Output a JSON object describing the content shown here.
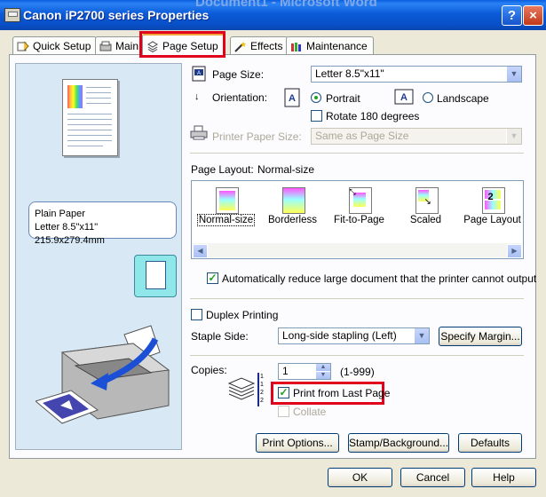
{
  "window": {
    "title": "Canon iP2700 series Properties",
    "background_title": "Document1 - Microsoft Word",
    "help_label": "?",
    "close_label": "×"
  },
  "tabs": [
    {
      "label": "Quick Setup",
      "icon": "quick-setup-icon"
    },
    {
      "label": "Main",
      "icon": "main-icon"
    },
    {
      "label": "Page Setup",
      "icon": "page-setup-icon",
      "active": true
    },
    {
      "label": "Effects",
      "icon": "effects-icon"
    },
    {
      "label": "Maintenance",
      "icon": "maintenance-icon"
    }
  ],
  "preview": {
    "media_line1": "Plain Paper",
    "media_line2": "Letter 8.5\"x11\" 215.9x279.4mm"
  },
  "form": {
    "page_size_label": "Page Size:",
    "page_size_value": "Letter 8.5\"x11\"",
    "orientation_label": "Orientation:",
    "portrait_label": "Portrait",
    "landscape_label": "Landscape",
    "portrait_selected": true,
    "rotate_label": "Rotate 180 degrees",
    "printer_paper_size_label": "Printer Paper Size:",
    "printer_paper_size_value": "Same as Page Size",
    "page_layout_label": "Page Layout:",
    "page_layout_value": "Normal-size",
    "layouts": [
      "Normal-size",
      "Borderless",
      "Fit-to-Page",
      "Scaled",
      "Page Layout"
    ],
    "auto_reduce_label": "Automatically reduce large document that the printer cannot output",
    "auto_reduce_checked": true,
    "duplex_label": "Duplex Printing",
    "staple_side_label": "Staple Side:",
    "staple_side_value": "Long-side stapling (Left)",
    "specify_margin_label": "Specify Margin...",
    "copies_label": "Copies:",
    "copies_value": "1",
    "copies_range": "(1-999)",
    "print_from_last_label": "Print from Last Page",
    "print_from_last_checked": true,
    "collate_label": "Collate",
    "print_options_label": "Print Options...",
    "stamp_label": "Stamp/Background...",
    "defaults_label": "Defaults"
  },
  "footer": {
    "ok_label": "OK",
    "cancel_label": "Cancel",
    "help_label": "Help"
  },
  "colors": {
    "highlight": "#e0001b",
    "titlebar": "#0b5bd8",
    "tab_accent": "#f1a33c"
  }
}
